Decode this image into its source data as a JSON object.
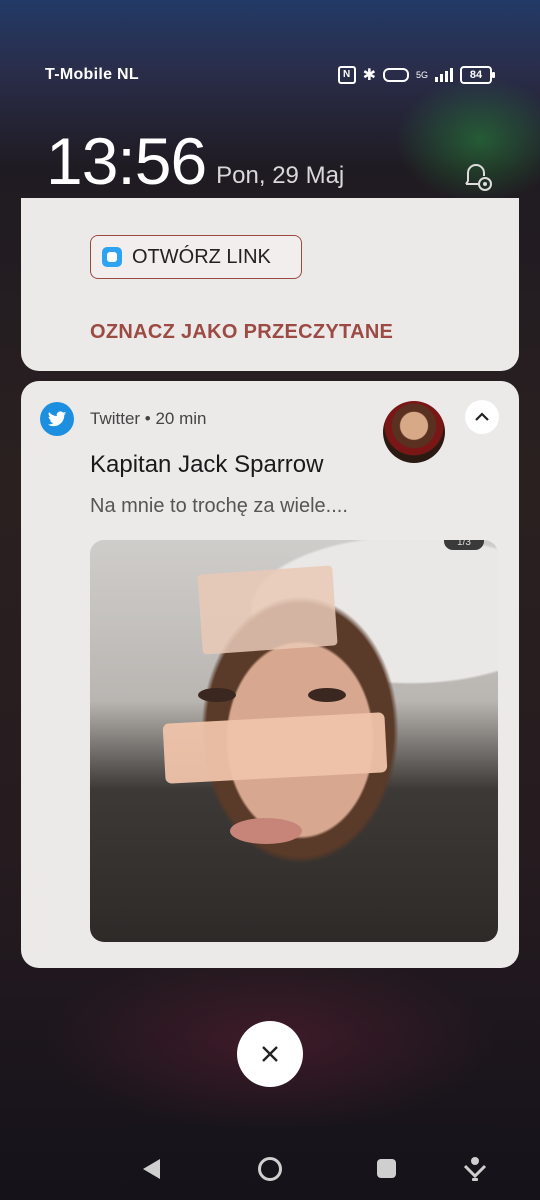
{
  "status_bar": {
    "carrier": "T-Mobile  NL",
    "nfc_label": "N",
    "network": "5G",
    "battery": "84"
  },
  "lockscreen": {
    "time": "13:56",
    "date": "Pon, 29 Maj"
  },
  "notification_prev": {
    "open_link_label": "OTWÓRZ LINK",
    "mark_read_label": "OZNACZ JAKO PRZECZYTANE"
  },
  "notification": {
    "app_meta": "Twitter • 20 min",
    "title": "Kapitan Jack Sparrow",
    "body": "Na mnie to trochę za wiele....",
    "photo_badge": "1/3"
  },
  "colors": {
    "action_accent": "#9c4a44",
    "twitter_blue": "#1d8fe0",
    "card_bg": "#ece9e9"
  },
  "icons": [
    "nfc-icon",
    "bluetooth-icon",
    "vibrate-icon",
    "signal-icon",
    "battery-icon",
    "bell-gear-icon",
    "link-icon",
    "twitter-icon",
    "chevron-up-icon",
    "close-icon",
    "back-icon",
    "home-icon",
    "recents-icon",
    "assistant-icon"
  ]
}
